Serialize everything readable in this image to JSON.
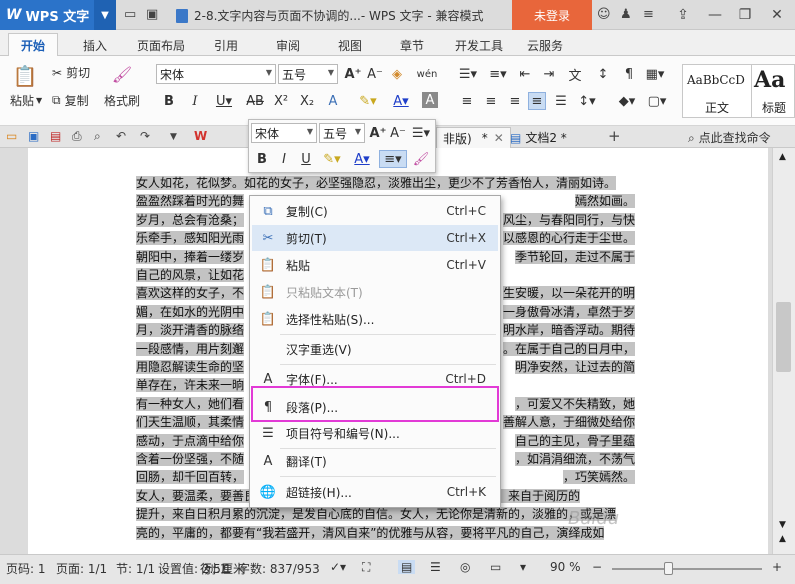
{
  "titlebar": {
    "app_name": "WPS 文字",
    "doc_title": "2-8.文字内容与页面不协调的...- WPS 文字 - 兼容模式",
    "login": "未登录"
  },
  "tabs": [
    "开始",
    "插入",
    "页面布局",
    "引用",
    "审阅",
    "视图",
    "章节",
    "开发工具",
    "云服务"
  ],
  "ribbon": {
    "paste": "粘贴",
    "cut": "剪切",
    "copy": "复制",
    "format_painter": "格式刷",
    "font_name": "宋体",
    "font_size": "五号",
    "style_sample_1": "AaBbCcD",
    "style_label_1": "正文",
    "style_sample_2": "Aa",
    "style_label_2": "标题"
  },
  "doctabs": {
    "tab1_suffix": "非版)",
    "tab1_mark": "*",
    "tab2": "文档2 *",
    "search": "点此查找命令"
  },
  "mini_toolbar": {
    "font_name": "宋体",
    "font_size": "五号"
  },
  "doc_lines": [
    "女人如花，花似梦。如花的女子，必坚强隐忍，淡雅出尘，更少不了芳香怡人，清丽如诗。",
    "盈盈然踩着时光的舞",
    "岁月，总会有沧桑；",
    "乐牵手，感知阳光雨",
    "朝阳中，捧着一缕岁",
    "自己的风景，让如花",
    "喜欢这样的女子，不",
    "媚，在如水的光阴中",
    "月，淡开清香的脉络",
    "一段感情，用片刻邂",
    "用隐忍解读生命的坚",
    "单存在，许未来一晌",
    "有一种女人，她们看",
    "们天生温顺，其柔情",
    "感动，于点滴中给你",
    "含着一份坚强，不随",
    "回肠，却千回百转，",
    "女人，要温柔，要善良，更要懂得坚强。这份坚强源于对生活的掌握，来自于阅历的",
    "提升，来自日积月累的沉淀，是发自心底的自信。女人，无论你是清新的，淡雅的，或是漂",
    "亮的，平庸的，都要有“我若盛开，清风自来”的优雅与从容，要将平凡的自己，演绎成如"
  ],
  "doc_tails": [
    "",
    "嫣然如画。",
    "风尘，与春阳同行，与快",
    "以感恩的心行走于尘世。",
    "季节轮回，走过不属于",
    "",
    "生安暖，以一朵花开的明",
    "一身傲骨冰清，卓然于岁",
    "明水岸，暗香浮动。期待",
    "。在属于自己的日月中，",
    "明净安然，让过去的简",
    "",
    "，可爱又不失精致，她",
    "善解人意，于细微处给你",
    "自己的主见，骨子里蕴",
    "，如涓涓细流，不荡气",
    "，巧笑嫣然。"
  ],
  "context_menu": {
    "items": [
      {
        "icon": "copy-icon",
        "label": "复制(C)",
        "shortcut": "Ctrl+C",
        "disabled": false
      },
      {
        "icon": "cut-icon",
        "label": "剪切(T)",
        "shortcut": "Ctrl+X",
        "disabled": false
      },
      {
        "icon": "paste-icon",
        "label": "粘贴",
        "shortcut": "Ctrl+V",
        "disabled": false
      },
      {
        "icon": "paste-text-icon",
        "label": "只粘贴文本(T)",
        "shortcut": "",
        "disabled": true
      },
      {
        "icon": "paste-special-icon",
        "label": "选择性粘贴(S)...",
        "shortcut": "",
        "disabled": false
      },
      {
        "icon": "",
        "label": "汉字重选(V)",
        "shortcut": "",
        "disabled": false
      },
      {
        "icon": "font-icon",
        "label": "字体(F)...",
        "shortcut": "Ctrl+D",
        "disabled": false
      },
      {
        "icon": "paragraph-icon",
        "label": "段落(P)...",
        "shortcut": "",
        "disabled": false
      },
      {
        "icon": "list-icon",
        "label": "项目符号和编号(N)...",
        "shortcut": "",
        "disabled": false
      },
      {
        "icon": "translate-icon",
        "label": "翻译(T)",
        "shortcut": "",
        "disabled": false
      },
      {
        "icon": "hyperlink-icon",
        "label": "超链接(H)...",
        "shortcut": "Ctrl+K",
        "disabled": false
      }
    ]
  },
  "statusbar": {
    "page": "页码: 1",
    "pages": "页面: 1/1",
    "section": "节: 1/1",
    "position": "设置值: 2.5厘米",
    "row": "行: 1",
    "col": "列: 1",
    "wordcount": "字数: 837/953",
    "zoom": "90 %"
  },
  "watermark": "Baidu"
}
